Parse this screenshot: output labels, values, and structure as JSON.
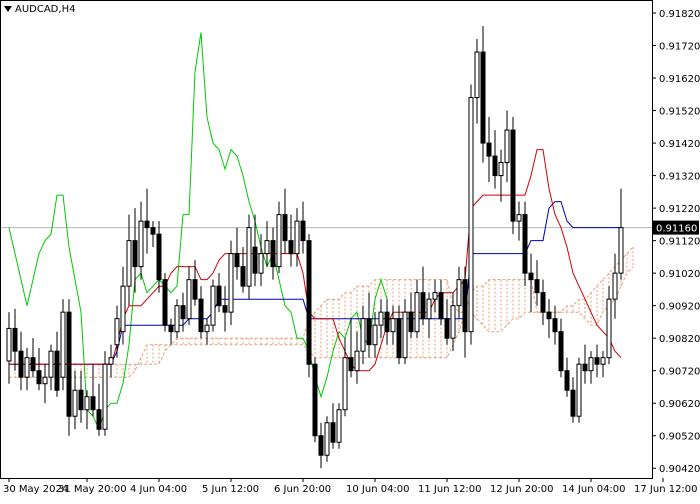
{
  "header": {
    "symbol_label": "AUDCAD,H4"
  },
  "colors": {
    "background": "#ffffff",
    "frame": "#000000",
    "candle_bull_fill": "#ffffff",
    "candle_bear_fill": "#000000",
    "candle_outline": "#000000",
    "tenkan": "#d40000",
    "kijun": "#0000b4",
    "chikou": "#00c800",
    "cloud_edge": "#e8a07a",
    "current_price_line": "#b4b4b4",
    "price_label_bg": "#000000",
    "price_label_text": "#ffffff"
  },
  "chart_data": {
    "type": "candlestick",
    "indicator": "Ichimoku",
    "symbol": "AUDCAD",
    "timeframe": "H4",
    "current_price": 0.9116,
    "current_price_label": "0.91160",
    "ylim": [
      0.9039,
      0.9186
    ],
    "y_ticks": [
      0.9042,
      0.9052,
      0.9062,
      0.9072,
      0.9082,
      0.9092,
      0.9102,
      0.9112,
      0.9122,
      0.9132,
      0.9142,
      0.9152,
      0.9162,
      0.9172,
      0.9182
    ],
    "y_tick_labels": [
      "0.90420",
      "0.90520",
      "0.90620",
      "0.90720",
      "0.90820",
      "0.90920",
      "0.91020",
      "0.91120",
      "0.91220",
      "0.91320",
      "0.91420",
      "0.91520",
      "0.91620",
      "0.91720",
      "0.91820"
    ],
    "x_ticks": [
      0,
      13,
      25,
      37,
      49,
      61,
      73,
      85,
      97,
      109
    ],
    "x_tick_labels": [
      "30 May 2024",
      "31 May 20:00",
      "4 Jun 04:00",
      "5 Jun 12:00",
      "6 Jun 20:00",
      "10 Jun 04:00",
      "11 Jun 12:00",
      "12 Jun 20:00",
      "14 Jun 04:00",
      "17 Jun 12:00"
    ],
    "candles": [
      [
        0.9075,
        0.909,
        0.9068,
        0.9085
      ],
      [
        0.9085,
        0.9091,
        0.9072,
        0.9078
      ],
      [
        0.9078,
        0.9084,
        0.9066,
        0.907
      ],
      [
        0.907,
        0.9079,
        0.9066,
        0.9076
      ],
      [
        0.9076,
        0.9082,
        0.907,
        0.9072
      ],
      [
        0.9072,
        0.9079,
        0.9066,
        0.9068
      ],
      [
        0.9068,
        0.9074,
        0.9062,
        0.907
      ],
      [
        0.907,
        0.908,
        0.9066,
        0.9078
      ],
      [
        0.9078,
        0.9084,
        0.9064,
        0.9066
      ],
      [
        0.907,
        0.9094,
        0.9066,
        0.909
      ],
      [
        0.909,
        0.9094,
        0.9052,
        0.9058
      ],
      [
        0.9058,
        0.9072,
        0.9054,
        0.9066
      ],
      [
        0.9066,
        0.9072,
        0.9056,
        0.906
      ],
      [
        0.906,
        0.9066,
        0.9054,
        0.9064
      ],
      [
        0.9064,
        0.9074,
        0.9058,
        0.906
      ],
      [
        0.906,
        0.9068,
        0.9052,
        0.9054
      ],
      [
        0.9054,
        0.9078,
        0.9052,
        0.9074
      ],
      [
        0.9074,
        0.908,
        0.907,
        0.9076
      ],
      [
        0.908,
        0.9092,
        0.9076,
        0.9088
      ],
      [
        0.9084,
        0.9104,
        0.908,
        0.9098
      ],
      [
        0.9098,
        0.912,
        0.9092,
        0.9112
      ],
      [
        0.9112,
        0.9122,
        0.9096,
        0.9104
      ],
      [
        0.9104,
        0.9124,
        0.91,
        0.9118
      ],
      [
        0.9118,
        0.9128,
        0.9108,
        0.9116
      ],
      [
        0.9116,
        0.9118,
        0.911,
        0.9114
      ],
      [
        0.9114,
        0.9118,
        0.9096,
        0.91
      ],
      [
        0.91,
        0.9102,
        0.9084,
        0.9086
      ],
      [
        0.9086,
        0.9088,
        0.908,
        0.9084
      ],
      [
        0.9084,
        0.9094,
        0.9082,
        0.9092
      ],
      [
        0.9092,
        0.9096,
        0.9084,
        0.9088
      ],
      [
        0.9088,
        0.9104,
        0.9086,
        0.91
      ],
      [
        0.91,
        0.9106,
        0.9092,
        0.9094
      ],
      [
        0.9094,
        0.9098,
        0.9082,
        0.9084
      ],
      [
        0.9084,
        0.9088,
        0.908,
        0.9086
      ],
      [
        0.9086,
        0.91,
        0.9084,
        0.9098
      ],
      [
        0.9098,
        0.9102,
        0.909,
        0.9092
      ],
      [
        0.9092,
        0.9098,
        0.9084,
        0.909
      ],
      [
        0.909,
        0.9112,
        0.9086,
        0.9108
      ],
      [
        0.9108,
        0.9116,
        0.91,
        0.9104
      ],
      [
        0.9104,
        0.911,
        0.9096,
        0.9098
      ],
      [
        0.9098,
        0.912,
        0.9094,
        0.9116
      ],
      [
        0.911,
        0.912,
        0.9098,
        0.9102
      ],
      [
        0.9102,
        0.9114,
        0.9098,
        0.9108
      ],
      [
        0.9108,
        0.9118,
        0.9104,
        0.9112
      ],
      [
        0.9112,
        0.9116,
        0.91,
        0.9104
      ],
      [
        0.9104,
        0.9124,
        0.9102,
        0.912
      ],
      [
        0.912,
        0.9128,
        0.9108,
        0.9112
      ],
      [
        0.9112,
        0.912,
        0.9104,
        0.9108
      ],
      [
        0.9108,
        0.9122,
        0.9104,
        0.9118
      ],
      [
        0.9118,
        0.9124,
        0.9108,
        0.9112
      ],
      [
        0.9112,
        0.9114,
        0.907,
        0.9074
      ],
      [
        0.9074,
        0.9076,
        0.905,
        0.9052
      ],
      [
        0.9052,
        0.9056,
        0.9042,
        0.9046
      ],
      [
        0.9046,
        0.9058,
        0.9044,
        0.9056
      ],
      [
        0.9056,
        0.9062,
        0.9048,
        0.905
      ],
      [
        0.905,
        0.9062,
        0.9048,
        0.906
      ],
      [
        0.906,
        0.9082,
        0.9058,
        0.9076
      ],
      [
        0.9076,
        0.9088,
        0.907,
        0.9072
      ],
      [
        0.9072,
        0.9084,
        0.9068,
        0.9078
      ],
      [
        0.9078,
        0.9092,
        0.9074,
        0.9088
      ],
      [
        0.9088,
        0.9096,
        0.9076,
        0.908
      ],
      [
        0.908,
        0.909,
        0.9076,
        0.9086
      ],
      [
        0.9086,
        0.9094,
        0.9082,
        0.909
      ],
      [
        0.909,
        0.9094,
        0.908,
        0.9084
      ],
      [
        0.9084,
        0.9092,
        0.908,
        0.9088
      ],
      [
        0.9088,
        0.9092,
        0.9074,
        0.9076
      ],
      [
        0.9076,
        0.9094,
        0.9074,
        0.909
      ],
      [
        0.909,
        0.9096,
        0.9082,
        0.9084
      ],
      [
        0.9084,
        0.91,
        0.9082,
        0.9096
      ],
      [
        0.9096,
        0.9104,
        0.9086,
        0.9088
      ],
      [
        0.9088,
        0.9096,
        0.9082,
        0.9094
      ],
      [
        0.9094,
        0.91,
        0.909,
        0.9096
      ],
      [
        0.9096,
        0.91,
        0.9086,
        0.9088
      ],
      [
        0.9088,
        0.9094,
        0.908,
        0.9082
      ],
      [
        0.9082,
        0.9096,
        0.9078,
        0.9092
      ],
      [
        0.9092,
        0.9104,
        0.9088,
        0.91
      ],
      [
        0.91,
        0.9104,
        0.9076,
        0.9084
      ],
      [
        0.9084,
        0.916,
        0.908,
        0.9156
      ],
      [
        0.9156,
        0.9174,
        0.9148,
        0.917
      ],
      [
        0.917,
        0.9178,
        0.9136,
        0.9142
      ],
      [
        0.9142,
        0.915,
        0.913,
        0.9138
      ],
      [
        0.9138,
        0.9146,
        0.9128,
        0.9132
      ],
      [
        0.9132,
        0.914,
        0.9124,
        0.9136
      ],
      [
        0.9136,
        0.9152,
        0.913,
        0.9146
      ],
      [
        0.9146,
        0.915,
        0.9114,
        0.9118
      ],
      [
        0.9118,
        0.9124,
        0.9112,
        0.912
      ],
      [
        0.912,
        0.9124,
        0.9098,
        0.9102
      ],
      [
        0.9102,
        0.9108,
        0.909,
        0.91
      ],
      [
        0.91,
        0.9106,
        0.9092,
        0.9096
      ],
      [
        0.9096,
        0.91,
        0.9086,
        0.909
      ],
      [
        0.909,
        0.9094,
        0.9082,
        0.9088
      ],
      [
        0.9088,
        0.9092,
        0.908,
        0.9084
      ],
      [
        0.9084,
        0.9088,
        0.907,
        0.9072
      ],
      [
        0.9072,
        0.9076,
        0.9064,
        0.9066
      ],
      [
        0.9066,
        0.907,
        0.9056,
        0.9058
      ],
      [
        0.9058,
        0.9076,
        0.9056,
        0.9074
      ],
      [
        0.9074,
        0.908,
        0.9068,
        0.9072
      ],
      [
        0.9072,
        0.9078,
        0.9068,
        0.9076
      ],
      [
        0.9076,
        0.908,
        0.907,
        0.9074
      ],
      [
        0.9074,
        0.9078,
        0.907,
        0.9076
      ],
      [
        0.9076,
        0.9098,
        0.9074,
        0.9094
      ],
      [
        0.9094,
        0.9108,
        0.9088,
        0.9102
      ],
      [
        0.9102,
        0.9128,
        0.91,
        0.9116
      ]
    ],
    "tenkan": [
      0.9074,
      0.9074,
      0.9074,
      0.9074,
      0.9074,
      0.9074,
      0.9074,
      0.9074,
      0.9074,
      0.9074,
      0.9074,
      0.9074,
      0.9074,
      0.9074,
      0.9074,
      0.9074,
      0.9074,
      0.9074,
      0.908,
      0.9088,
      0.9092,
      0.9092,
      0.9092,
      0.9094,
      0.9096,
      0.9098,
      0.9098,
      0.9102,
      0.9104,
      0.9104,
      0.9104,
      0.9104,
      0.91,
      0.91,
      0.9102,
      0.9106,
      0.9108,
      0.9108,
      0.9108,
      0.9108,
      0.9108,
      0.9108,
      0.9108,
      0.9108,
      0.9108,
      0.9108,
      0.9108,
      0.9108,
      0.9108,
      0.9102,
      0.909,
      0.9088,
      0.9088,
      0.9088,
      0.9088,
      0.9082,
      0.9078,
      0.9074,
      0.9072,
      0.9072,
      0.9072,
      0.9074,
      0.908,
      0.9086,
      0.909,
      0.909,
      0.909,
      0.909,
      0.909,
      0.909,
      0.909,
      0.9094,
      0.9096,
      0.9096,
      0.9096,
      0.9098,
      0.91,
      0.9122,
      0.9124,
      0.9126,
      0.9126,
      0.9126,
      0.9126,
      0.9126,
      0.9126,
      0.9126,
      0.9126,
      0.9132,
      0.914,
      0.914,
      0.9128,
      0.912,
      0.9116,
      0.911,
      0.9102,
      0.9098,
      0.9094,
      0.909,
      0.9086,
      0.9084,
      0.9082,
      0.9078,
      0.9076
    ],
    "kijun": [
      0.9074,
      0.9074,
      0.9074,
      0.9074,
      0.9074,
      0.9074,
      0.9074,
      0.9074,
      0.9074,
      0.9074,
      0.9074,
      0.9074,
      0.9074,
      0.9074,
      0.9074,
      0.9074,
      0.9074,
      0.9074,
      0.9078,
      0.9086,
      0.9086,
      0.9086,
      0.9086,
      0.9086,
      0.9086,
      0.9086,
      0.9086,
      0.9086,
      0.9086,
      0.9086,
      0.9088,
      0.9088,
      0.9088,
      0.9088,
      0.909,
      0.9094,
      0.9094,
      0.9094,
      0.9094,
      0.9094,
      0.9094,
      0.9094,
      0.9094,
      0.9094,
      0.9094,
      0.9094,
      0.9094,
      0.9094,
      0.9094,
      0.9094,
      0.9088,
      0.9088,
      0.9088,
      0.9088,
      0.9088,
      0.9088,
      0.9088,
      0.9088,
      0.9088,
      0.9088,
      0.9088,
      0.9088,
      0.9088,
      0.9088,
      0.9088,
      0.9088,
      0.9088,
      0.9088,
      0.9088,
      0.9088,
      0.9088,
      0.9088,
      0.9088,
      0.9088,
      0.9088,
      0.9088,
      0.9088,
      0.9108,
      0.9108,
      0.9108,
      0.9108,
      0.9108,
      0.9108,
      0.9108,
      0.9108,
      0.9108,
      0.9108,
      0.9112,
      0.9112,
      0.9112,
      0.9122,
      0.9124,
      0.9124,
      0.9118,
      0.9116,
      0.9116,
      0.9116,
      0.9116,
      0.9116,
      0.9116,
      0.9116,
      0.9116,
      0.9116
    ],
    "chikou": [
      0.9116,
      0.9108,
      0.91,
      0.9092,
      0.91,
      0.9108,
      0.9112,
      0.9114,
      0.9126,
      0.9126,
      0.911,
      0.91,
      0.909,
      0.906,
      0.9058,
      0.9054,
      0.906,
      0.9062,
      0.9062,
      0.9068,
      0.908,
      0.91,
      0.9102,
      0.9096,
      0.9098,
      0.91,
      0.9098,
      0.9096,
      0.9098,
      0.912,
      0.912,
      0.9164,
      0.9176,
      0.915,
      0.9142,
      0.914,
      0.9134,
      0.914,
      0.9138,
      0.9132,
      0.9124,
      0.9118,
      0.911,
      0.9104,
      0.9108,
      0.91,
      0.9092,
      0.909,
      0.9082,
      0.9082,
      0.9078,
      0.907,
      0.9064,
      0.907,
      0.9078,
      0.9084,
      0.9082,
      0.9088,
      0.909,
      0.9082,
      0.908,
      0.9094,
      0.91,
      0.9094
    ],
    "senkou_a": [
      0.9074,
      0.9074,
      0.9074,
      0.9074,
      0.9074,
      0.9074,
      0.9074,
      0.9074,
      0.9074,
      0.9074,
      0.9074,
      0.9074,
      0.9074,
      0.9074,
      0.9074,
      0.9074,
      0.9074,
      0.9074,
      0.9074,
      0.9074,
      0.9074,
      0.9074,
      0.9074,
      0.9074,
      0.9074,
      0.9074,
      0.9078,
      0.908,
      0.9082,
      0.9082,
      0.9082,
      0.9082,
      0.9082,
      0.9082,
      0.9082,
      0.9082,
      0.9082,
      0.9082,
      0.9082,
      0.9082,
      0.9082,
      0.9082,
      0.9082,
      0.9082,
      0.9082,
      0.9082,
      0.9082,
      0.9082,
      0.9082,
      0.9082,
      0.9088,
      0.909,
      0.9092,
      0.9094,
      0.9094,
      0.9094,
      0.9096,
      0.9096,
      0.9098,
      0.9098,
      0.9098,
      0.91,
      0.91,
      0.91,
      0.91,
      0.91,
      0.91,
      0.91,
      0.91,
      0.91,
      0.91,
      0.91,
      0.91,
      0.91,
      0.9092,
      0.909,
      0.909,
      0.909,
      0.9088,
      0.9086,
      0.9084,
      0.9084,
      0.9084,
      0.9086,
      0.9088,
      0.9088,
      0.909,
      0.909,
      0.909,
      0.909,
      0.909,
      0.909,
      0.909,
      0.9092,
      0.9092,
      0.9094,
      0.9094,
      0.9096,
      0.9098,
      0.91,
      0.9102,
      0.9104,
      0.9106,
      0.9108,
      0.911
    ],
    "senkou_b": [
      0.907,
      0.907,
      0.907,
      0.907,
      0.907,
      0.907,
      0.907,
      0.907,
      0.907,
      0.907,
      0.907,
      0.907,
      0.907,
      0.907,
      0.907,
      0.907,
      0.907,
      0.907,
      0.907,
      0.907,
      0.907,
      0.9072,
      0.9076,
      0.908,
      0.908,
      0.908,
      0.908,
      0.908,
      0.908,
      0.908,
      0.908,
      0.908,
      0.908,
      0.908,
      0.908,
      0.908,
      0.908,
      0.908,
      0.908,
      0.908,
      0.908,
      0.908,
      0.908,
      0.908,
      0.908,
      0.908,
      0.908,
      0.908,
      0.908,
      0.908,
      0.9078,
      0.9076,
      0.9076,
      0.9076,
      0.9076,
      0.9076,
      0.9076,
      0.9076,
      0.9076,
      0.9076,
      0.9076,
      0.9076,
      0.9076,
      0.9076,
      0.9076,
      0.9076,
      0.9076,
      0.9076,
      0.9076,
      0.9076,
      0.9076,
      0.9076,
      0.9076,
      0.9076,
      0.908,
      0.9084,
      0.909,
      0.9096,
      0.9098,
      0.9098,
      0.91,
      0.91,
      0.91,
      0.91,
      0.91,
      0.91,
      0.91,
      0.91,
      0.909,
      0.909,
      0.909,
      0.909,
      0.909,
      0.909,
      0.909,
      0.909,
      0.9088,
      0.9086,
      0.9086,
      0.909,
      0.9092,
      0.9094,
      0.9098,
      0.9102,
      0.9104
    ]
  }
}
